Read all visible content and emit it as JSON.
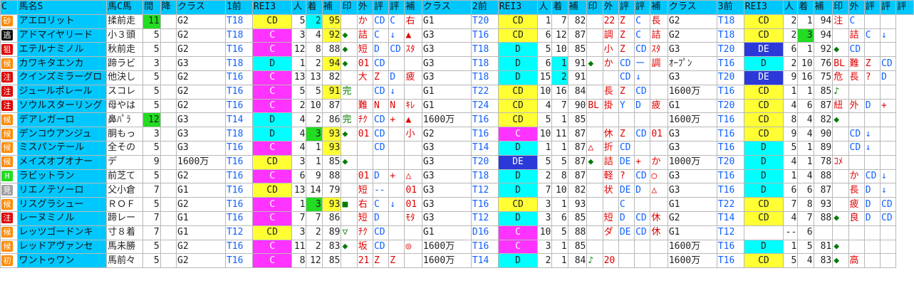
{
  "headers": [
    "C",
    "馬名S",
    "馬C馬",
    "間",
    "降",
    "クラス",
    "1前",
    "REI3",
    "人",
    "着",
    "補",
    "印",
    "外",
    "評",
    "評",
    "補",
    "クラス",
    "2前",
    "REI3",
    "人",
    "着",
    "補",
    "印",
    "外",
    "評",
    "評",
    "補",
    "クラス",
    "3前",
    "REI3",
    "人",
    "着",
    "補",
    "印",
    "外",
    "評",
    "評",
    "評"
  ],
  "rows": [
    {
      "ic": "砂",
      "ic_bg": "#ff8a00",
      "ic_fg": "#fff",
      "name": "アエロリット",
      "c2": "揉前走",
      "int": "11",
      "int_bg": "#22dd22",
      "cls1": "G2",
      "t1": "T18",
      "r1": "CD",
      "r1_bg": "#ffff33",
      "p1": "5",
      "p1_bg": "",
      "ch1": "2",
      "ch1_bg": "#00ffff",
      "h1": "95",
      "h1_bg": "#ffff33",
      "m1": "",
      "e1": "か",
      "e2": "CD",
      "e3": "C",
      "e4": "右",
      "cls2": "G1",
      "t2": "T20",
      "r2": "CD",
      "r2_bg": "#ffff33",
      "p2": "1",
      "ch2": "7",
      "ch2_bg": "",
      "h2": "82",
      "m2": "",
      "f1": "22",
      "f2": "Z",
      "f3": "C",
      "f4": "長",
      "cls3": "G2",
      "t3": "T18",
      "r3": "CD",
      "r3_bg": "#ffff33",
      "p3": "2",
      "ch3": "1",
      "ch3_bg": "",
      "h3": "94",
      "g1": "注",
      "g2": "C",
      "g3": "",
      "g4": ""
    },
    {
      "ic": "逃",
      "ic_bg": "#111",
      "ic_fg": "#fff",
      "name": "アドマイヤリード",
      "c2": "小３頭",
      "int": "5",
      "int_bg": "",
      "cls1": "G2",
      "t1": "T18",
      "r1": "C",
      "r1_bg": "#ff33ff",
      "p1": "3",
      "ch1": "4",
      "ch1_bg": "",
      "h1": "92",
      "h1_bg": "#ffff33",
      "m1": "◆",
      "e1": "詰",
      "e2": "C",
      "e3": "↓",
      "e4": "▲",
      "cls2": "G3",
      "t2": "T16",
      "r2": "CD",
      "r2_bg": "#ffff33",
      "p2": "6",
      "ch2": "12",
      "ch2_bg": "",
      "h2": "87",
      "m2": "",
      "f1": "調",
      "f2": "Z",
      "f3": "C",
      "f4": "詰",
      "cls3": "G2",
      "t3": "T18",
      "r3": "CD",
      "r3_bg": "#ffff33",
      "p3": "2",
      "ch3": "3",
      "ch3_bg": "#22dd22",
      "h3": "94",
      "g1": "",
      "g2": "詰",
      "g3": "C",
      "g4": "↓"
    },
    {
      "ic": "狙",
      "ic_bg": "#e00000",
      "ic_fg": "#fff",
      "name": "エテルナミノル",
      "c2": "秋前走",
      "int": "5",
      "int_bg": "",
      "cls1": "G2",
      "t1": "T16",
      "r1": "C",
      "r1_bg": "#ff33ff",
      "p1": "12",
      "ch1": "8",
      "ch1_bg": "",
      "h1": "88",
      "h1_bg": "",
      "m1": "◆",
      "e1": "短",
      "e2": "D",
      "e3": "CD",
      "e4": "ｽﾀ",
      "cls2": "G3",
      "t2": "T18",
      "r2": "D",
      "r2_bg": "#00ffff",
      "p2": "5",
      "ch2": "10",
      "ch2_bg": "",
      "h2": "85",
      "m2": "",
      "f1": "小",
      "f2": "Z",
      "f3": "CD",
      "f4": "ｽﾀ",
      "cls3": "G3",
      "t3": "T20",
      "r3": "DE",
      "r3_bg": "#2b39d9",
      "p3": "6",
      "ch3": "1",
      "ch3_bg": "",
      "h3": "92",
      "g1": "◆",
      "g2": "CD",
      "g3": "",
      "g4": ""
    },
    {
      "ic": "候",
      "ic_bg": "#ff8a00",
      "ic_fg": "#fff",
      "name": "カワキタエンカ",
      "c2": "蹄ラビ",
      "int": "3",
      "int_bg": "",
      "cls1": "G3",
      "t1": "T18",
      "r1": "D",
      "r1_bg": "#00ffff",
      "p1": "1",
      "ch1": "2",
      "ch1_bg": "",
      "h1": "94",
      "h1_bg": "#ffff33",
      "m1": "◆",
      "e1": "01",
      "e2": "CD",
      "e3": "",
      "e4": "",
      "cls2": "G3",
      "t2": "T18",
      "r2": "D",
      "r2_bg": "#00ffff",
      "p2": "6",
      "ch2": "1",
      "ch2_bg": "#00ffff",
      "h2": "91",
      "m2": "◆",
      "f1": "か",
      "f2": "CD",
      "f3": "ー",
      "f4": "調",
      "cls3": "ｵｰﾌﾟﾝ",
      "t3": "T16",
      "r3": "D",
      "r3_bg": "#00ffff",
      "p3": "2",
      "ch3": "10",
      "ch3_bg": "",
      "h3": "76",
      "g1": "BL",
      "g2": "難",
      "g3": "Z",
      "g4": "CD"
    },
    {
      "ic": "注",
      "ic_bg": "#e00000",
      "ic_fg": "#fff",
      "name": "クインズミラーグロ",
      "c2": "他決し",
      "int": "5",
      "int_bg": "",
      "cls1": "G2",
      "t1": "T16",
      "r1": "C",
      "r1_bg": "#ff33ff",
      "p1": "13",
      "ch1": "13",
      "ch1_bg": "",
      "h1": "82",
      "h1_bg": "",
      "m1": "",
      "e1": "大",
      "e2": "Z",
      "e3": "D",
      "e4": "疲",
      "cls2": "G3",
      "t2": "T18",
      "r2": "D",
      "r2_bg": "#00ffff",
      "p2": "15",
      "ch2": "2",
      "ch2_bg": "#00ffff",
      "h2": "91",
      "m2": "",
      "f1": "",
      "f2": "CD",
      "f3": "↓",
      "f4": "",
      "cls3": "G3",
      "t3": "T20",
      "r3": "DE",
      "r3_bg": "#2b39d9",
      "p3": "9",
      "ch3": "16",
      "ch3_bg": "",
      "h3": "75",
      "g1": "危",
      "g2": "長",
      "g3": "?",
      "g4": "D"
    },
    {
      "ic": "注",
      "ic_bg": "#e00000",
      "ic_fg": "#fff",
      "name": "ジュールポレール",
      "c2": "スコレ",
      "int": "5",
      "int_bg": "",
      "cls1": "G2",
      "t1": "T16",
      "r1": "C",
      "r1_bg": "#ff33ff",
      "p1": "5",
      "ch1": "5",
      "ch1_bg": "",
      "h1": "91",
      "h1_bg": "#ffff33",
      "m1": "完",
      "e1": "",
      "e2": "CD",
      "e3": "↓",
      "e4": "",
      "cls2": "G1",
      "t2": "T22",
      "r2": "CD",
      "r2_bg": "#ffff33",
      "p2": "10",
      "ch2": "16",
      "ch2_bg": "",
      "h2": "84",
      "m2": "",
      "f1": "長",
      "f2": "Z",
      "f3": "CD",
      "f4": "",
      "cls3": "1600万",
      "t3": "T16",
      "r3": "CD",
      "r3_bg": "#ffff33",
      "p3": "1",
      "ch3": "1",
      "ch3_bg": "",
      "h3": "85",
      "g1": "♪",
      "g2": "",
      "g3": "",
      "g4": ""
    },
    {
      "ic": "注",
      "ic_bg": "#e00000",
      "ic_fg": "#fff",
      "name": "ソウルスターリング",
      "c2": "母やは",
      "int": "5",
      "int_bg": "",
      "cls1": "G2",
      "t1": "T16",
      "r1": "C",
      "r1_bg": "#ff33ff",
      "p1": "2",
      "ch1": "10",
      "ch1_bg": "",
      "h1": "87",
      "h1_bg": "",
      "m1": "",
      "e1": "難",
      "e2": "N",
      "e3": "N",
      "e4": "ｷﾚ",
      "cls2": "G1",
      "t2": "T24",
      "r2": "CD",
      "r2_bg": "#ffff33",
      "p2": "4",
      "ch2": "7",
      "ch2_bg": "",
      "h2": "90",
      "m2": "BL",
      "f1": "掛",
      "f2": "Y",
      "f3": "D",
      "f4": "疲",
      "cls3": "G1",
      "t3": "T20",
      "r3": "CD",
      "r3_bg": "#ffff33",
      "p3": "4",
      "ch3": "6",
      "ch3_bg": "",
      "h3": "87",
      "g1": "紐",
      "g2": "外",
      "g3": "D",
      "g4": "+"
    },
    {
      "ic": "候",
      "ic_bg": "#ff8a00",
      "ic_fg": "#fff",
      "name": "デアレガーロ",
      "c2": "鼻ﾊﾟﾗ",
      "int": "12",
      "int_bg": "#22dd22",
      "cls1": "G3",
      "t1": "T14",
      "r1": "D",
      "r1_bg": "#00ffff",
      "p1": "4",
      "ch1": "2",
      "ch1_bg": "",
      "h1": "86",
      "h1_bg": "",
      "m1": "完",
      "e1": "ﾁｸ",
      "e2": "CD",
      "e3": "+",
      "e4": "▲",
      "cls2": "1600万",
      "t2": "T16",
      "r2": "CD",
      "r2_bg": "#ffff33",
      "p2": "5",
      "ch2": "1",
      "ch2_bg": "",
      "h2": "85",
      "m2": "",
      "f1": "",
      "f2": "",
      "f3": "",
      "f4": "",
      "cls3": "1600万",
      "t3": "T16",
      "r3": "CD",
      "r3_bg": "#ffff33",
      "p3": "8",
      "ch3": "4",
      "ch3_bg": "",
      "h3": "82",
      "g1": "◆",
      "g2": "",
      "g3": "",
      "g4": ""
    },
    {
      "ic": "候",
      "ic_bg": "#ff8a00",
      "ic_fg": "#fff",
      "name": "デンコウアンジュ",
      "c2": "胴もっ",
      "int": "3",
      "int_bg": "",
      "cls1": "G3",
      "t1": "T18",
      "r1": "D",
      "r1_bg": "#00ffff",
      "p1": "4",
      "ch1": "3",
      "ch1_bg": "#22dd22",
      "h1": "93",
      "h1_bg": "#ffff33",
      "m1": "◆",
      "e1": "01",
      "e2": "CD",
      "e3": "",
      "e4": "小",
      "cls2": "G2",
      "t2": "T16",
      "r2": "C",
      "r2_bg": "#ff33ff",
      "p2": "10",
      "ch2": "11",
      "ch2_bg": "",
      "h2": "87",
      "m2": "",
      "f1": "休",
      "f2": "Z",
      "f3": "CD",
      "f4": "01",
      "cls3": "G3",
      "t3": "T16",
      "r3": "CD",
      "r3_bg": "#ffff33",
      "p3": "9",
      "ch3": "4",
      "ch3_bg": "",
      "h3": "90",
      "g1": "",
      "g2": "CD",
      "g3": "↓",
      "g4": ""
    },
    {
      "ic": "候",
      "ic_bg": "#ff8a00",
      "ic_fg": "#fff",
      "name": "ミスパンテール",
      "c2": "全その",
      "int": "5",
      "int_bg": "",
      "cls1": "G3",
      "t1": "T16",
      "r1": "C",
      "r1_bg": "#ff33ff",
      "p1": "4",
      "ch1": "1",
      "ch1_bg": "",
      "h1": "93",
      "h1_bg": "#ffff33",
      "m1": "",
      "e1": "",
      "e2": "CD",
      "e3": "",
      "e4": "",
      "cls2": "G3",
      "t2": "T14",
      "r2": "D",
      "r2_bg": "#00ffff",
      "p2": "1",
      "ch2": "1",
      "ch2_bg": "",
      "h2": "87",
      "m2": "△",
      "f1": "折",
      "f2": "CD",
      "f3": "",
      "f4": "",
      "cls3": "G3",
      "t3": "T16",
      "r3": "D",
      "r3_bg": "#00ffff",
      "p3": "5",
      "ch3": "1",
      "ch3_bg": "",
      "h3": "89",
      "g1": "",
      "g2": "CD",
      "g3": "↓",
      "g4": ""
    },
    {
      "ic": "候",
      "ic_bg": "#ff8a00",
      "ic_fg": "#fff",
      "name": "メイズオブオナー",
      "c2": "デ",
      "int": "9",
      "int_bg": "",
      "cls1": "1600万",
      "t1": "T16",
      "r1": "CD",
      "r1_bg": "#ffff33",
      "p1": "3",
      "ch1": "1",
      "ch1_bg": "",
      "h1": "85",
      "h1_bg": "",
      "m1": "◆",
      "e1": "",
      "e2": "",
      "e3": "",
      "e4": "",
      "cls2": "G3",
      "t2": "T20",
      "r2": "DE",
      "r2_bg": "#2b39d9",
      "p2": "5",
      "ch2": "5",
      "ch2_bg": "",
      "h2": "87",
      "m2": "◆",
      "f1": "詰",
      "f2": "DE",
      "f3": "+",
      "f4": "か",
      "cls3": "1000万",
      "t3": "T20",
      "r3": "D",
      "r3_bg": "#00ffff",
      "p3": "4",
      "ch3": "1",
      "ch3_bg": "",
      "h3": "78",
      "g1": "ｺﾒ",
      "g2": "",
      "g3": "",
      "g4": ""
    },
    {
      "ic": "H",
      "ic_bg": "#22dd22",
      "ic_fg": "#fff",
      "name": "ラビットラン",
      "c2": "前芝て",
      "int": "5",
      "int_bg": "",
      "cls1": "G2",
      "t1": "T16",
      "r1": "C",
      "r1_bg": "#ff33ff",
      "p1": "6",
      "ch1": "9",
      "ch1_bg": "",
      "h1": "88",
      "h1_bg": "",
      "m1": "",
      "e1": "01",
      "e2": "D",
      "e3": "+",
      "e4": "△",
      "cls2": "G3",
      "t2": "T18",
      "r2": "D",
      "r2_bg": "#00ffff",
      "p2": "2",
      "ch2": "8",
      "ch2_bg": "",
      "h2": "87",
      "m2": "",
      "f1": "軽",
      "f2": "?",
      "f3": "CD",
      "f4": "○",
      "cls3": "G3",
      "t3": "T16",
      "r3": "D",
      "r3_bg": "#00ffff",
      "p3": "1",
      "ch3": "4",
      "ch3_bg": "",
      "h3": "88",
      "g1": "",
      "g2": "か",
      "g3": "CD",
      "g4": "↓"
    },
    {
      "ic": "見",
      "ic_bg": "#a0a0a0",
      "ic_fg": "#fff",
      "name": "リエノテソーロ",
      "c2": "父小倉",
      "int": "7",
      "int_bg": "",
      "cls1": "G1",
      "t1": "T16",
      "r1": "CD",
      "r1_bg": "#ffff33",
      "p1": "13",
      "ch1": "14",
      "ch1_bg": "",
      "h1": "79",
      "h1_bg": "",
      "m1": "",
      "e1": "短",
      "e2": "--",
      "e3": "",
      "e4": "01",
      "cls2": "G3",
      "t2": "T12",
      "r2": "D",
      "r2_bg": "#00ffff",
      "p2": "7",
      "ch2": "10",
      "ch2_bg": "",
      "h2": "82",
      "m2": "",
      "f1": "状",
      "f2": "DE",
      "f3": "D",
      "f4": "△",
      "cls3": "G3",
      "t3": "T16",
      "r3": "D",
      "r3_bg": "#00ffff",
      "p3": "6",
      "ch3": "6",
      "ch3_bg": "",
      "h3": "87",
      "g1": "",
      "g2": "長",
      "g3": "D",
      "g4": "↓"
    },
    {
      "ic": "候",
      "ic_bg": "#ff8a00",
      "ic_fg": "#fff",
      "name": "リスグラシュー",
      "c2": "ＲＯＦ",
      "int": "5",
      "int_bg": "",
      "cls1": "G2",
      "t1": "T16",
      "r1": "C",
      "r1_bg": "#ff33ff",
      "p1": "1",
      "ch1": "3",
      "ch1_bg": "#22dd22",
      "h1": "93",
      "h1_bg": "#ffff33",
      "m1": "■",
      "e1": "右",
      "e2": "C",
      "e3": "↓",
      "e4": "01",
      "cls2": "G3",
      "t2": "T16",
      "r2": "CD",
      "r2_bg": "#ffff33",
      "p2": "3",
      "ch2": "1",
      "ch2_bg": "",
      "h2": "93",
      "m2": "",
      "f1": "",
      "f2": "C",
      "f3": "",
      "f4": "",
      "cls3": "G1",
      "t3": "T22",
      "r3": "CD",
      "r3_bg": "#ffff33",
      "p3": "7",
      "ch3": "8",
      "ch3_bg": "",
      "h3": "93",
      "g1": "",
      "g2": "疲",
      "g3": "D",
      "g4": "CD"
    },
    {
      "ic": "注",
      "ic_bg": "#e00000",
      "ic_fg": "#fff",
      "name": "レーヌミノル",
      "c2": "蹄レー",
      "int": "7",
      "int_bg": "",
      "cls1": "G1",
      "t1": "T16",
      "r1": "C",
      "r1_bg": "#ff33ff",
      "p1": "7",
      "ch1": "7",
      "ch1_bg": "",
      "h1": "86",
      "h1_bg": "",
      "m1": "",
      "e1": "短",
      "e2": "D",
      "e3": "",
      "e4": "ﾓﾀ",
      "cls2": "G3",
      "t2": "T12",
      "r2": "D",
      "r2_bg": "#00ffff",
      "p2": "3",
      "ch2": "6",
      "ch2_bg": "",
      "h2": "85",
      "m2": "",
      "f1": "短",
      "f2": "D",
      "f3": "CD",
      "f4": "休",
      "cls3": "G2",
      "t3": "T14",
      "r3": "CD",
      "r3_bg": "#ffff33",
      "p3": "4",
      "ch3": "7",
      "ch3_bg": "",
      "h3": "88",
      "g1": "◆",
      "g2": "良",
      "g3": "D",
      "g4": "CD"
    },
    {
      "ic": "候",
      "ic_bg": "#ff8a00",
      "ic_fg": "#fff",
      "name": "レッツゴードンキ",
      "c2": "寸８着",
      "int": "7",
      "int_bg": "",
      "cls1": "G1",
      "t1": "T12",
      "r1": "CD",
      "r1_bg": "#ffff33",
      "p1": "3",
      "ch1": "2",
      "ch1_bg": "",
      "h1": "89",
      "h1_bg": "",
      "m1": "▽",
      "e1": "ﾁｸ",
      "e2": "CD",
      "e3": "",
      "e4": "",
      "cls2": "G1",
      "t2": "D16",
      "r2": "C",
      "r2_bg": "#ff33ff",
      "p2": "10",
      "ch2": "5",
      "ch2_bg": "",
      "h2": "88",
      "m2": "",
      "f1": "ダ",
      "f2": "DE",
      "f3": "CD",
      "f4": "休",
      "cls3": "G1",
      "t3": "T12",
      "r3": "",
      "r3_bg": "",
      "p3": "--",
      "ch3": "6",
      "ch3_bg": "",
      "h3": "",
      "g1": "",
      "g2": "",
      "g3": "",
      "g4": ""
    },
    {
      "ic": "候",
      "ic_bg": "#ff8a00",
      "ic_fg": "#fff",
      "name": "レッドアヴァンセ",
      "c2": "馬未勝",
      "int": "5",
      "int_bg": "",
      "cls1": "G2",
      "t1": "T16",
      "r1": "C",
      "r1_bg": "#ff33ff",
      "p1": "11",
      "ch1": "2",
      "ch1_bg": "",
      "h1": "83",
      "h1_bg": "",
      "m1": "◆",
      "e1": "坂",
      "e2": "CD",
      "e3": "",
      "e4": "◎",
      "cls2": "1600万",
      "t2": "T16",
      "r2": "C",
      "r2_bg": "#ff33ff",
      "p2": "3",
      "ch2": "1",
      "ch2_bg": "",
      "h2": "85",
      "m2": "",
      "f1": "",
      "f2": "",
      "f3": "",
      "f4": "",
      "cls3": "1600万",
      "t3": "T16",
      "r3": "D",
      "r3_bg": "#00ffff",
      "p3": "1",
      "ch3": "5",
      "ch3_bg": "",
      "h3": "81",
      "g1": "◆",
      "g2": "",
      "g3": "",
      "g4": ""
    },
    {
      "ic": "初",
      "ic_bg": "#ff8a00",
      "ic_fg": "#fff",
      "name": "ワントゥワン",
      "c2": "馬前々",
      "int": "5",
      "int_bg": "",
      "cls1": "G2",
      "t1": "T16",
      "r1": "C",
      "r1_bg": "#ff33ff",
      "p1": "8",
      "ch1": "12",
      "ch1_bg": "",
      "h1": "85",
      "h1_bg": "",
      "m1": "",
      "e1": "21",
      "e2": "Z",
      "e3": "Z",
      "e4": "",
      "cls2": "1600万",
      "t2": "T14",
      "r2": "D",
      "r2_bg": "#00ffff",
      "p2": "2",
      "ch2": "1",
      "ch2_bg": "",
      "h2": "84",
      "m2": "♪",
      "f1": "20",
      "f2": "",
      "f3": "",
      "f4": "",
      "cls3": "1600万",
      "t3": "T16",
      "r3": "CD",
      "r3_bg": "#ffff33",
      "p3": "5",
      "ch3": "4",
      "ch3_bg": "",
      "h3": "83",
      "g1": "◆",
      "g2": "高",
      "g3": "",
      "g4": ""
    }
  ]
}
